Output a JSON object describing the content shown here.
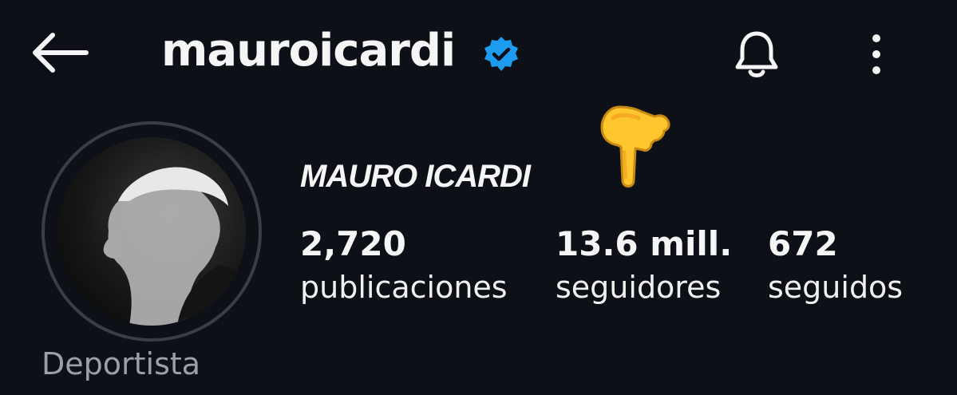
{
  "header": {
    "back_icon": "arrow-left-icon",
    "username": "mauroicardi",
    "verified_icon": "verified-badge-icon",
    "verified_color": "#1d9bf0",
    "bell_icon": "bell-icon",
    "more_icon": "more-vertical-icon"
  },
  "overlay": {
    "emoji": "pointing-down-hand-icon"
  },
  "profile": {
    "avatar": "profile-photo",
    "display_name": "MAURO ICARDI",
    "category": "Deportista",
    "stats": [
      {
        "value": "2,720",
        "label": "publicaciones"
      },
      {
        "value": "13.6 mill.",
        "label": "seguidores"
      },
      {
        "value": "672",
        "label": "seguidos"
      }
    ]
  },
  "colors": {
    "background": "#0d1016",
    "text": "#f5f5f5",
    "muted": "#9aa0a6",
    "ring": "#3a3d45"
  }
}
